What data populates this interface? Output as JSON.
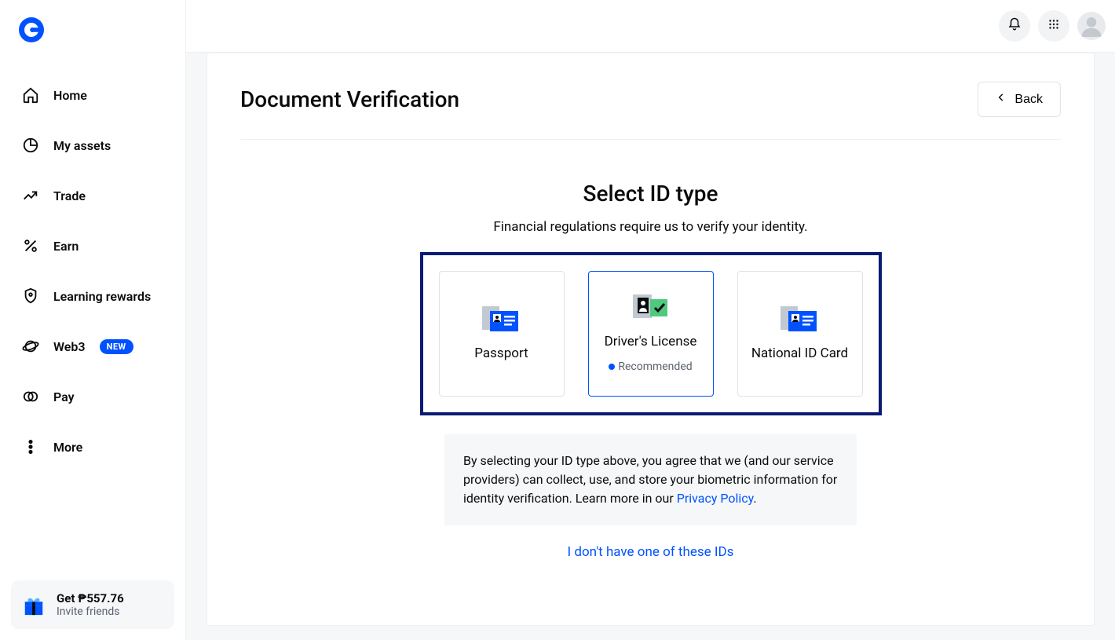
{
  "sidebar": {
    "items": [
      {
        "label": "Home"
      },
      {
        "label": "My assets"
      },
      {
        "label": "Trade"
      },
      {
        "label": "Earn"
      },
      {
        "label": "Learning rewards"
      },
      {
        "label": "Web3",
        "badge": "NEW"
      },
      {
        "label": "Pay"
      },
      {
        "label": "More"
      }
    ],
    "promo": {
      "title": "Get ₱557.76",
      "subtitle": "Invite friends"
    }
  },
  "page": {
    "title": "Document Verification",
    "back_label": "Back",
    "heading": "Select ID type",
    "subtext": "Financial regulations require us to verify your identity.",
    "options": [
      {
        "label": "Passport"
      },
      {
        "label": "Driver's License",
        "recommended": "Recommended"
      },
      {
        "label": "National ID Card"
      }
    ],
    "consent_text_1": "By selecting your ID type above, you agree that we (and our service providers) can collect, use, and store your biometric information for identity verification. Learn more in our ",
    "consent_link": "Privacy Policy",
    "consent_text_2": ".",
    "alt_link": "I don't have one of these IDs"
  }
}
